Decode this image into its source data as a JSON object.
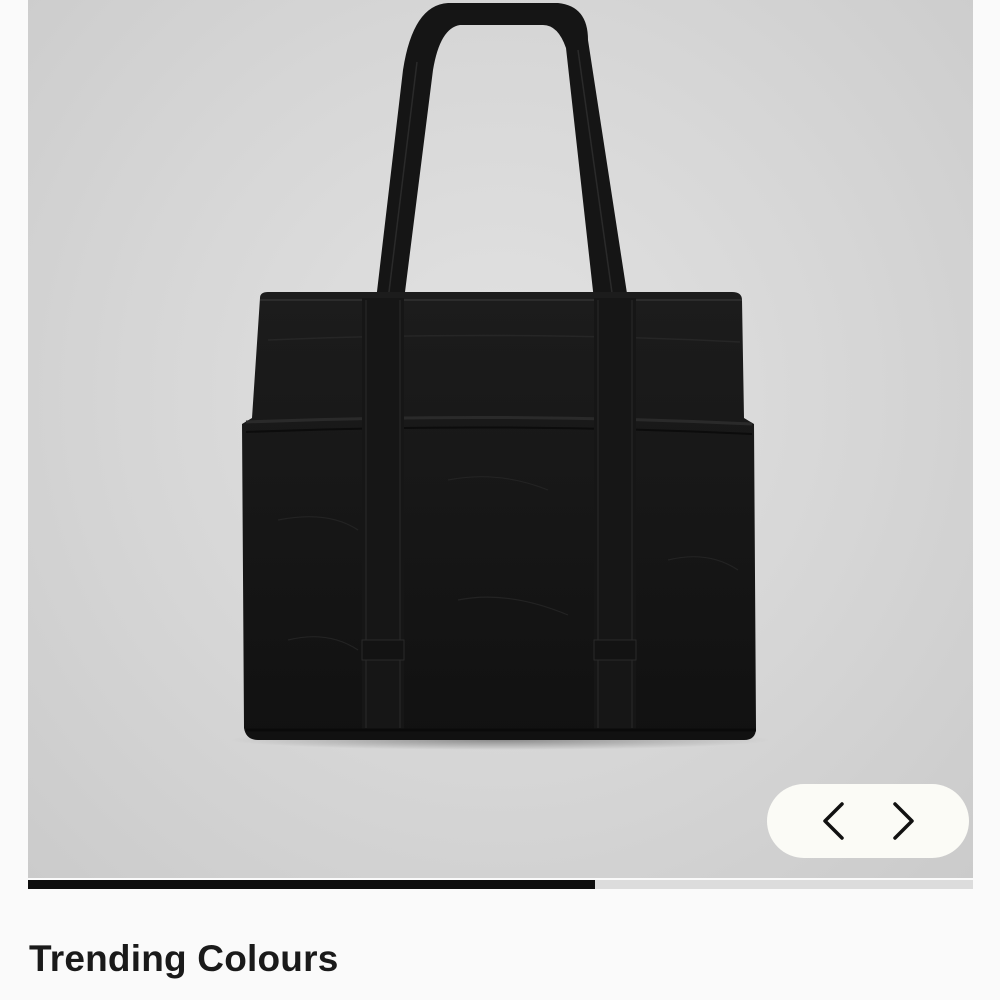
{
  "carousel": {
    "image_alt": "Black tote bag with long shoulder straps and exterior side pockets",
    "progress_fraction": 0.6,
    "prev_icon": "chevron-left-icon",
    "next_icon": "chevron-right-icon"
  },
  "section": {
    "title": "Trending Colours"
  },
  "colors": {
    "progress_fill": "#0d0d0d",
    "progress_track": "#dcdcdc",
    "nav_pill": "#fbfbf6",
    "background": "#fafafa"
  }
}
